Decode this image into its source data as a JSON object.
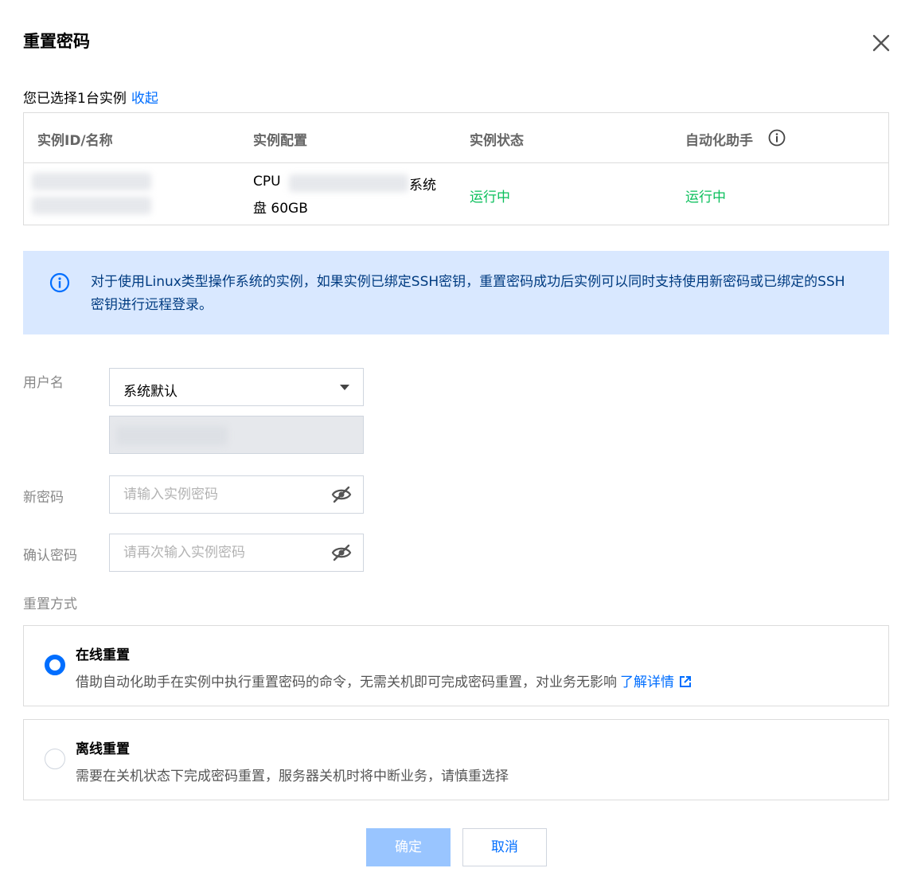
{
  "dialog": {
    "title": "重置密码"
  },
  "selection": {
    "text": "您已选择1台实例",
    "collapse_link": "收起"
  },
  "table": {
    "headers": [
      "实例ID/名称",
      "实例配置",
      "实例状态",
      "自动化助手"
    ],
    "row": {
      "config_prefix": "CPU",
      "config_suffix": "系统",
      "config_line2": "盘 60GB",
      "status": "运行中",
      "assistant_status": "运行中"
    }
  },
  "notice": {
    "text": "对于使用Linux类型操作系统的实例，如果实例已绑定SSH密钥，重置密码成功后实例可以同时支持使用新密码或已绑定的SSH密钥进行远程登录。"
  },
  "form": {
    "username_label": "用户名",
    "username_value": "系统默认",
    "new_password_label": "新密码",
    "new_password_placeholder": "请输入实例密码",
    "confirm_password_label": "确认密码",
    "confirm_password_placeholder": "请再次输入实例密码",
    "reset_method_label": "重置方式"
  },
  "options": {
    "online": {
      "title": "在线重置",
      "desc": "借助自动化助手在实例中执行重置密码的命令，无需关机即可完成密码重置，对业务无影响",
      "link": "了解详情",
      "selected": true
    },
    "offline": {
      "title": "离线重置",
      "desc": "需要在关机状态下完成密码重置，服务器关机时将中断业务，请慎重选择",
      "selected": false
    }
  },
  "buttons": {
    "ok": "确定",
    "cancel": "取消"
  },
  "colors": {
    "primary": "#006eff",
    "success": "#0abf5b",
    "notice_bg": "#d9e8ff",
    "disabled_button": "#99c5ff"
  }
}
